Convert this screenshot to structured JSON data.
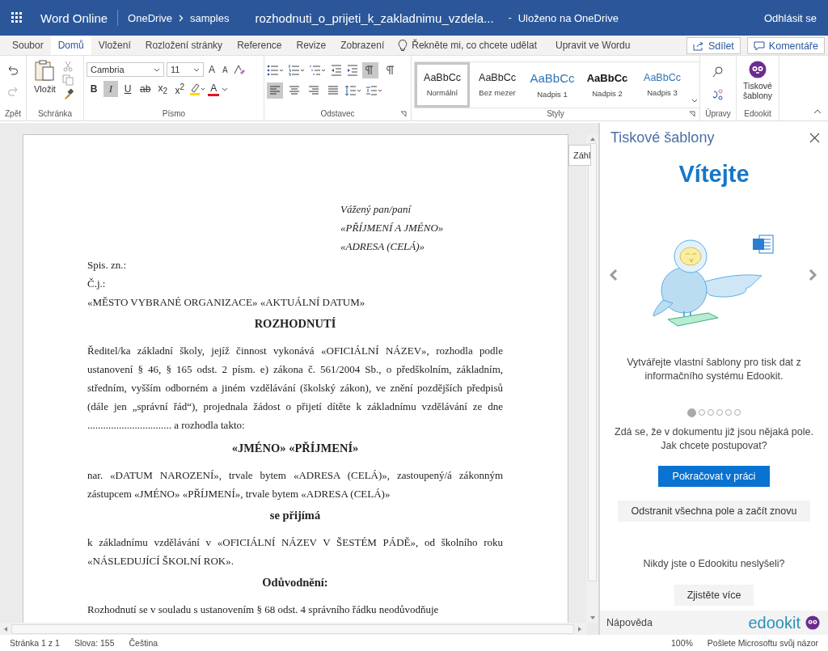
{
  "title_bar": {
    "app_name": "Word Online",
    "breadcrumb": [
      "OneDrive",
      "samples"
    ],
    "document_name": "rozhodnuti_o_prijeti_k_zakladnimu_vzdela...",
    "separator": "-",
    "save_status": "Uloženo na OneDrive",
    "sign_out": "Odhlásit se"
  },
  "menu_tabs": [
    {
      "label": "Soubor",
      "selected": false
    },
    {
      "label": "Domů",
      "selected": true
    },
    {
      "label": "Vložení",
      "selected": false
    },
    {
      "label": "Rozložení stránky",
      "selected": false
    },
    {
      "label": "Reference",
      "selected": false
    },
    {
      "label": "Revize",
      "selected": false
    },
    {
      "label": "Zobrazení",
      "selected": false
    }
  ],
  "tell_me": "Řekněte mi, co chcete udělat",
  "edit_in_word": "Upravit ve Wordu",
  "share": "Sdílet",
  "comments": "Komentáře",
  "ribbon": {
    "undo_group": "Zpět",
    "paste": "Vložit",
    "clipboard_group": "Schránka",
    "font_name": "Cambria",
    "font_size": "11",
    "grow_font": "A",
    "shrink_font": "A",
    "font_group": "Písmo",
    "font_buttons": [
      {
        "kind": "bold",
        "label": "B",
        "pressed": false
      },
      {
        "kind": "italic",
        "label": "I",
        "pressed": true
      },
      {
        "kind": "underline",
        "label": "U",
        "pressed": false
      },
      {
        "kind": "strike",
        "label": "ab",
        "pressed": false
      },
      {
        "kind": "sub",
        "label": "x$_{2}$",
        "pressed": false
      },
      {
        "kind": "sup",
        "label": "x$^{2}$",
        "pressed": false
      }
    ],
    "font_color": "A",
    "paragraph_direction": [
      {
        "kind": "ltr",
        "pressed": true
      },
      {
        "kind": "rtl",
        "pressed": false
      }
    ],
    "alignment": [
      {
        "kind": "left",
        "selected": true
      },
      {
        "kind": "center",
        "selected": false
      },
      {
        "kind": "right",
        "selected": false
      },
      {
        "kind": "justify",
        "selected": false
      }
    ],
    "paragraph_group": "Odstavec",
    "styles": [
      {
        "kind": "normal",
        "preview": "AaBbCc",
        "name": "Normální",
        "selected": true
      },
      {
        "kind": "nospace",
        "preview": "AaBbCc",
        "name": "Bez mezer",
        "selected": false
      },
      {
        "kind": "h1",
        "preview": "AaBbCc",
        "name": "Nadpis 1",
        "selected": false
      },
      {
        "kind": "h2",
        "preview": "AaBbCc",
        "name": "Nadpis 2",
        "selected": false
      },
      {
        "kind": "h3",
        "preview": "AaBbCc",
        "name": "Nadpis 3",
        "selected": false
      }
    ],
    "styles_group": "Styly",
    "editing_group": "Úpravy",
    "templates_button": "Tiskové šablony",
    "edookit_group": "Edookit"
  },
  "document": {
    "side_tab": "Záhl",
    "paragraphs": [
      {
        "kind": "address",
        "text": "Vážený pan/paní"
      },
      {
        "kind": "address",
        "text": "«PŘÍJMENÍ A JMÉNO»"
      },
      {
        "kind": "address",
        "text": "«ADRESA (CELÁ)»"
      },
      {
        "kind": "line",
        "text": "Spis. zn.:"
      },
      {
        "kind": "line",
        "text": "Č.j.:"
      },
      {
        "kind": "line",
        "text": "«MĚSTO VYBRANÉ ORGANIZACE» «AKTUÁLNÍ DATUM»"
      },
      {
        "kind": "heading",
        "text": "ROZHODNUTÍ"
      },
      {
        "kind": "body",
        "text": "Ředitel/ka základní školy, jejíž činnost vykonává «OFICIÁLNÍ NÁZEV», rozhodla podle ustanovení § 46, § 165 odst. 2 písm. e) zákona č. 561/2004 Sb., o předškolním, základním, středním, vyšším odborném a jiném vzdělávání (školský zákon), ve znění pozdějších předpisů (dále jen „správní řád“), projednala žádost o přijetí dítěte k základnímu vzdělávání ze dne ................................ a rozhodla takto:"
      },
      {
        "kind": "name",
        "text": "«JMÉNO» «PŘÍJMENÍ»"
      },
      {
        "kind": "body",
        "text": "nar. «DATUM NAROZENÍ», trvale bytem «ADRESA (CELÁ)», zastoupený/á zákonným zástupcem «JMÉNO» «PŘÍJMENÍ», trvale bytem «ADRESA (CELÁ)»"
      },
      {
        "kind": "heading",
        "text": "se přijímá"
      },
      {
        "kind": "body",
        "text": "k základnímu vzdělávání v «OFICIÁLNÍ NÁZEV V ŠESTÉM PÁDĚ», od školního roku «NÁSLEDUJÍCÍ ŠKOLNÍ ROK»."
      },
      {
        "kind": "heading",
        "text": "Odůvodnění:"
      },
      {
        "kind": "line",
        "text": "Rozhodnutí se v souladu s ustanovením § 68 odst. 4 správního řádku neodůvodňuje"
      }
    ]
  },
  "side_pane": {
    "title": "Tiskové šablony",
    "welcome": "Vítejte",
    "description": "Vytvářejte vlastní šablony pro tisk dat z informačního systému Edookit.",
    "slides": [
      {
        "selected": true
      },
      {
        "selected": false
      },
      {
        "selected": false
      },
      {
        "selected": false
      },
      {
        "selected": false
      },
      {
        "selected": false
      }
    ],
    "question": "Zdá se, že v dokumentu již jsou nějaká pole. Jak chcete postupovat?",
    "continue_button": "Pokračovat v práci",
    "reset_button": "Odstranit všechna pole a začít znovu",
    "never_heard": "Nikdy jste o Edookitu neslyšeli?",
    "learn_more": "Zjistěte více",
    "help": "Nápověda",
    "logo_text": "edookit"
  },
  "status_bar": {
    "page": "Stránka 1 z 1",
    "words": "Slova: 155",
    "language": "Čeština",
    "zoom": "100%",
    "feedback": "Pošlete Microsoftu svůj názor"
  }
}
